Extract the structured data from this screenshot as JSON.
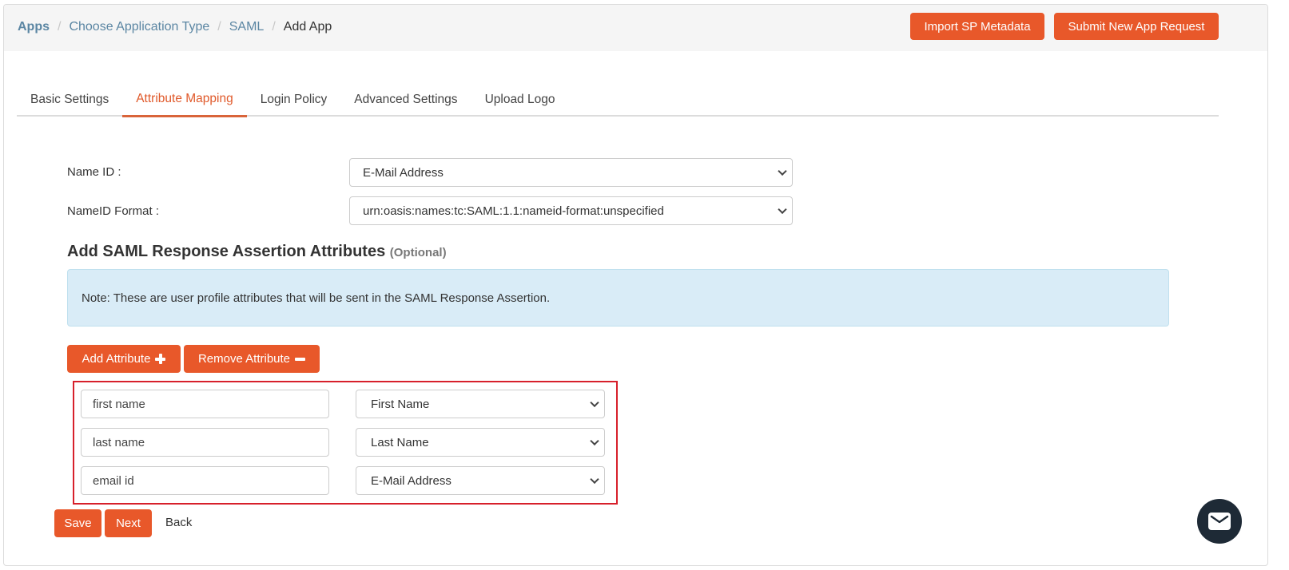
{
  "header": {
    "breadcrumb": [
      "Apps",
      "Choose Application Type",
      "SAML",
      "Add App"
    ],
    "buttons": {
      "import": "Import SP Metadata",
      "submit": "Submit New App Request"
    }
  },
  "tabs": [
    {
      "label": "Basic Settings",
      "active": false
    },
    {
      "label": "Attribute Mapping",
      "active": true
    },
    {
      "label": "Login Policy",
      "active": false
    },
    {
      "label": "Advanced Settings",
      "active": false
    },
    {
      "label": "Upload Logo",
      "active": false
    }
  ],
  "form": {
    "name_id": {
      "label": "Name ID :",
      "value": "E-Mail Address"
    },
    "name_id_format": {
      "label": "NameID Format :",
      "value": "urn:oasis:names:tc:SAML:1.1:nameid-format:unspecified"
    }
  },
  "section": {
    "title": "Add SAML Response Assertion Attributes",
    "optional": "(Optional)",
    "note": "Note: These are user profile attributes that will be sent in the SAML Response Assertion."
  },
  "attribute_buttons": {
    "add": "Add Attribute",
    "remove": "Remove Attribute"
  },
  "attributes": [
    {
      "name": "first name",
      "mapping": "First Name"
    },
    {
      "name": "last name",
      "mapping": "Last Name"
    },
    {
      "name": "email id",
      "mapping": "E-Mail Address"
    }
  ],
  "footer": {
    "save": "Save",
    "next": "Next",
    "back": "Back"
  },
  "colors": {
    "accent": "#e8582a",
    "link": "#5b86a3",
    "highlight_border": "#d7202b",
    "note_bg": "#d9ecf7"
  },
  "icons": {
    "add": "plus-icon",
    "remove": "minus-icon",
    "chat": "mail-icon",
    "dropdown": "chevron-down-icon"
  }
}
